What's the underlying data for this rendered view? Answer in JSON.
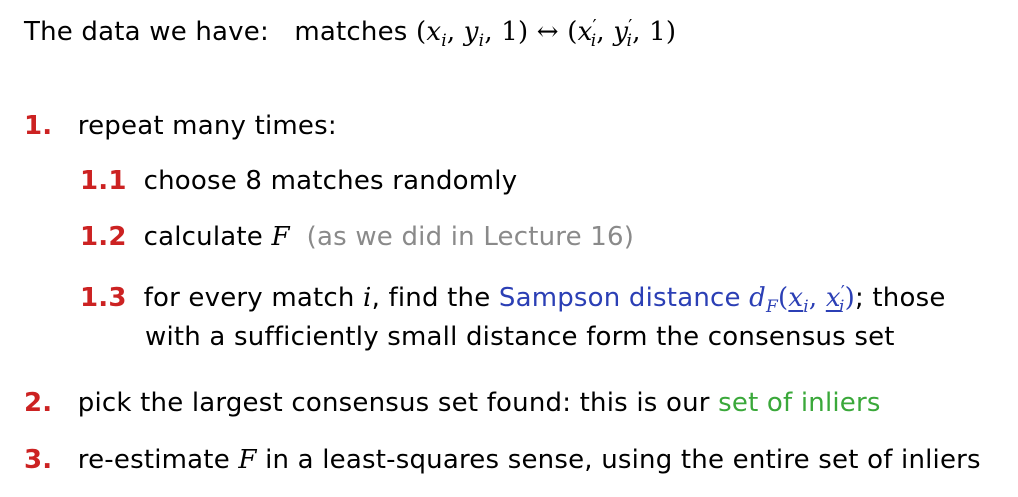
{
  "header": {
    "lead": "The data we have:",
    "matches_word": "matches",
    "tuple_left_open": "(",
    "x": "x",
    "i_sub": "i",
    "comma": ",",
    "y": "y",
    "one": "1",
    "tuple_close": ")",
    "arrow": "↔",
    "prime": "′"
  },
  "steps": {
    "s1": {
      "num": "1.",
      "text": "repeat many times:"
    },
    "s11": {
      "num": "1.1",
      "text": "choose 8 matches randomly"
    },
    "s12": {
      "num": "1.2",
      "text_before": "calculate",
      "var": "F",
      "note": "(as we did in Lecture 16)"
    },
    "s13": {
      "num": "1.3",
      "text_a": "for every match",
      "var_i": "i",
      "text_b": ", find the",
      "term": "Sampson distance",
      "d": "d",
      "F_sub": "F",
      "text_c": "; those",
      "line2": "with a sufficiently small distance form the consensus set"
    },
    "s2": {
      "num": "2.",
      "text": "pick the largest consensus set found: this is our",
      "term": "set of inliers"
    },
    "s3": {
      "num": "3.",
      "text_a": "re-estimate",
      "var": "F",
      "text_b": "in a least-squares sense, using the entire set of inliers"
    }
  },
  "colors": {
    "number_red": "#cc2222",
    "note_gray": "#8a8a8a",
    "term_blue": "#2b3fb5",
    "term_green": "#3aa83a"
  }
}
